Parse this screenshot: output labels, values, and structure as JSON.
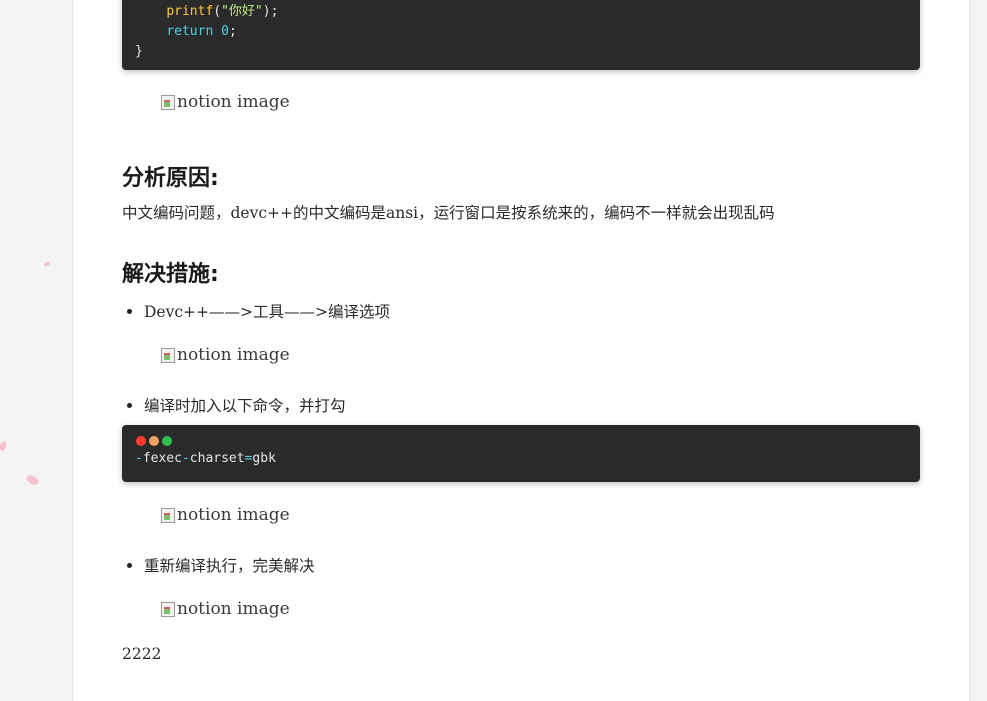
{
  "code_top": {
    "line1_fn": "printf",
    "line1_open": "(",
    "line1_str": "\"你好\"",
    "line1_close": ");",
    "line2_kw": "return",
    "line2_num": "0",
    "line2_end": ";",
    "line3": "}"
  },
  "image_alt": "notion image",
  "section1": {
    "heading": "分析原因:",
    "text": "中文编码问题，devc++的中文编码是ansi，运行窗口是按系统来的，编码不一样就会出现乱码"
  },
  "section2": {
    "heading": "解决措施:",
    "bullet1": "Devc++——>工具——>编译选项",
    "bullet2": "编译时加入以下命令，并打勾",
    "bullet3": "重新编译执行，完美解决"
  },
  "code_gbk": {
    "dash1": "-",
    "word1": "fexec",
    "dash2": "-",
    "word2": "charset",
    "eq": "=",
    "word3": "gbk"
  },
  "footer_text": "2222",
  "colors": {
    "dot_red": "#ff3b30",
    "dot_orange": "#f0a35e",
    "dot_green": "#2ec04a",
    "code_bg": "#2a2a2a"
  }
}
